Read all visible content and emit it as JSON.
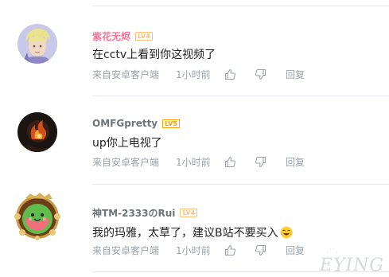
{
  "comments": [
    {
      "username": "紫花无烬",
      "level": "LV4",
      "name_color": "#fb7299",
      "level_color": "#fbc17c",
      "content": "在cctv上看到你这视频了",
      "source": "来自安卓客户端",
      "time": "1小时前",
      "reply_label": "回复",
      "avatar_icon": "anime-character-avatar"
    },
    {
      "username": "OMFGpretty",
      "level": "LV5",
      "name_color": "#6d757a",
      "level_color": "#ff9c00",
      "content": "up你上电视了",
      "source": "来自安卓客户端",
      "time": "1小时前",
      "reply_label": "回复",
      "avatar_icon": "flame-avatar"
    },
    {
      "username": "神TM-2333のRui",
      "level": "LV4",
      "name_color": "#6d757a",
      "level_color": "#fbc17c",
      "content": "我的玛雅，太草了，建议B站不要买入",
      "emoji_icon": "laughing-emoji",
      "source": "来自安卓客户端",
      "time": "1小时前",
      "reply_label": "回复",
      "avatar_icon": "watermelon-frame-avatar"
    }
  ],
  "watermark": "EYING",
  "watermark_small": "·ˊˋ·"
}
